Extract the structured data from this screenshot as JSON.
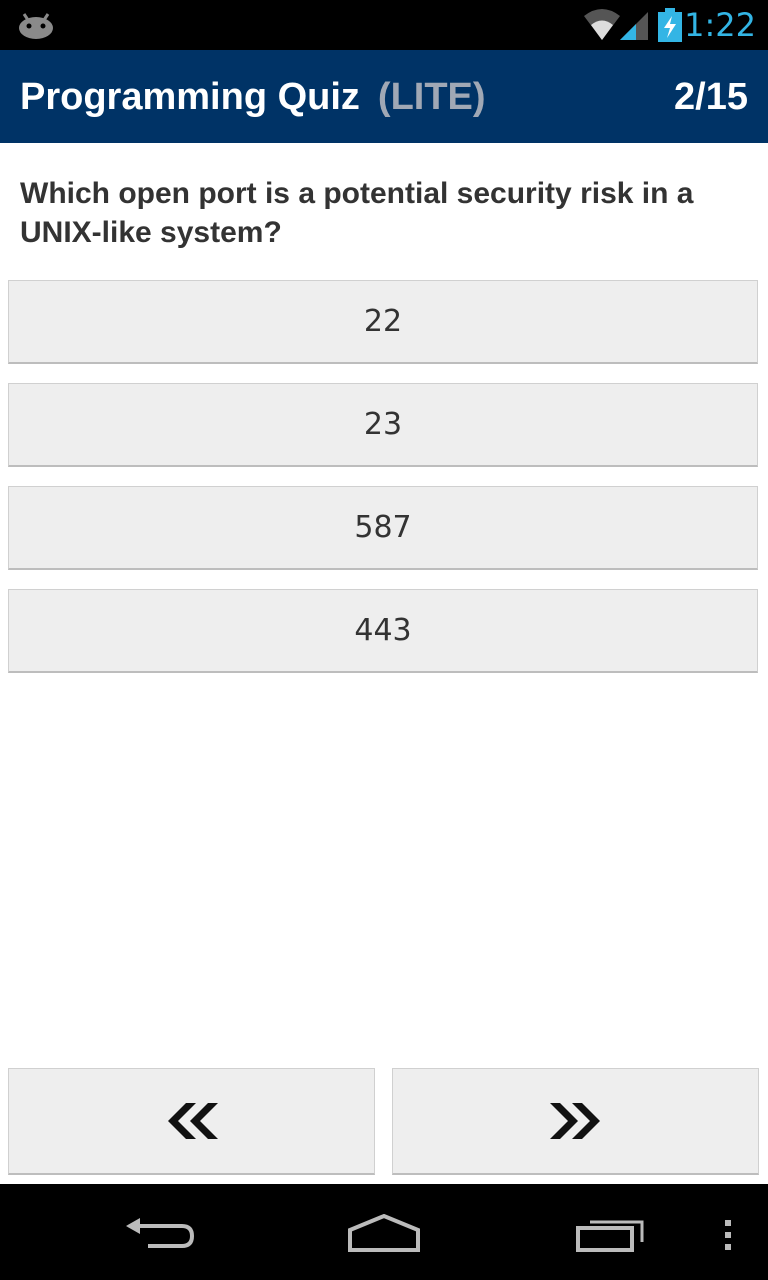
{
  "status_bar": {
    "time": "1:22",
    "icons": [
      "android-icon",
      "wifi-icon",
      "signal-icon",
      "battery-charging-icon"
    ],
    "clock_color": "#33b5e5"
  },
  "header": {
    "title": "Programming Quiz",
    "badge": "(LITE)",
    "progress": "2/15",
    "background": "#003366"
  },
  "question": {
    "text": "Which open port is a potential security risk in a UNIX-like system?"
  },
  "answers": [
    {
      "label": "22"
    },
    {
      "label": "23"
    },
    {
      "label": "587"
    },
    {
      "label": "443"
    }
  ],
  "navigation": {
    "prev_icon": "double-chevron-left-icon",
    "next_icon": "double-chevron-right-icon"
  },
  "system_nav": {
    "icons": [
      "back-icon",
      "home-icon",
      "recent-apps-icon",
      "overflow-menu-icon"
    ]
  }
}
